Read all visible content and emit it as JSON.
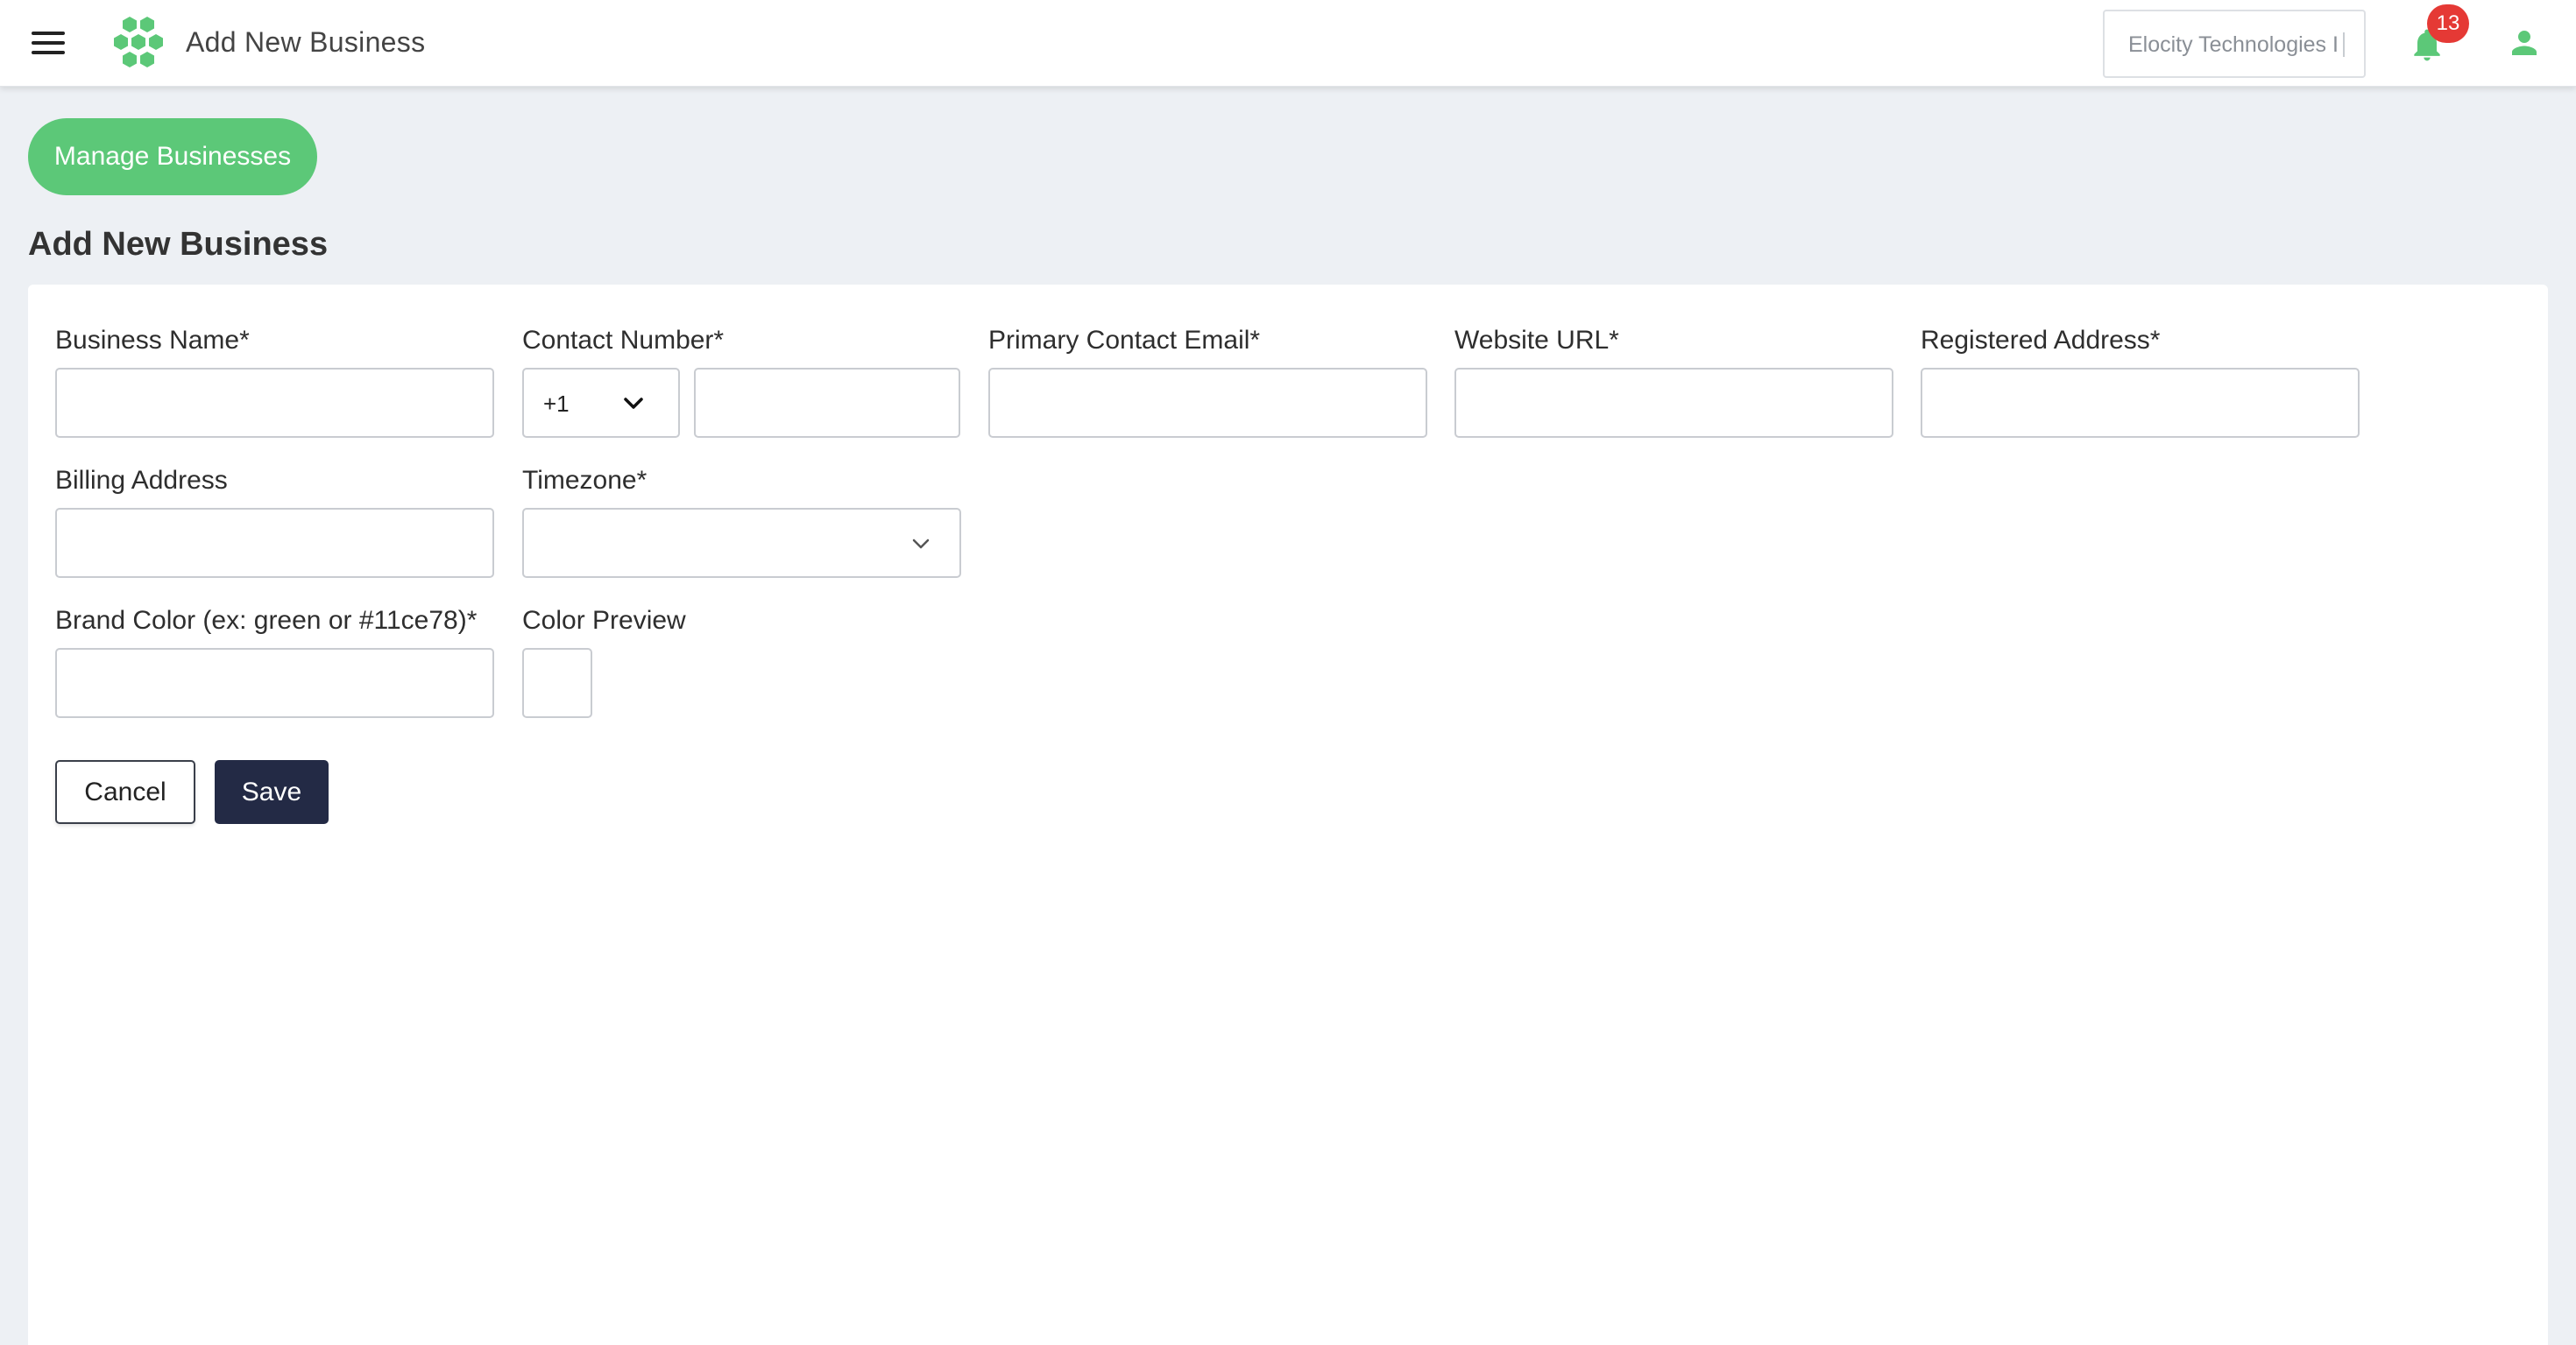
{
  "header": {
    "title": "Add New Business",
    "organization": "Elocity Technologies I",
    "notification_count": "13",
    "brand_color": "#5cc878",
    "menu_icon": "hamburger-icon",
    "logo_icon": "hexagon-cluster-logo",
    "bell_icon": "bell-icon",
    "user_icon": "user-icon"
  },
  "page": {
    "manage_button": "Manage Businesses",
    "title": "Add New Business"
  },
  "form": {
    "business_name": {
      "label": "Business Name*",
      "value": ""
    },
    "contact_number": {
      "label": "Contact Number*",
      "country_code": "+1",
      "value": ""
    },
    "primary_email": {
      "label": "Primary Contact Email*",
      "value": ""
    },
    "website": {
      "label": "Website URL*",
      "value": ""
    },
    "registered_address": {
      "label": "Registered Address*",
      "value": ""
    },
    "billing_address": {
      "label": "Billing Address",
      "value": ""
    },
    "timezone": {
      "label": "Timezone*",
      "value": ""
    },
    "brand_color": {
      "label": "Brand Color (ex: green or #11ce78)*",
      "value": ""
    },
    "color_preview": {
      "label": "Color Preview"
    },
    "cancel_label": "Cancel",
    "save_label": "Save",
    "save_color": "#232a45"
  }
}
